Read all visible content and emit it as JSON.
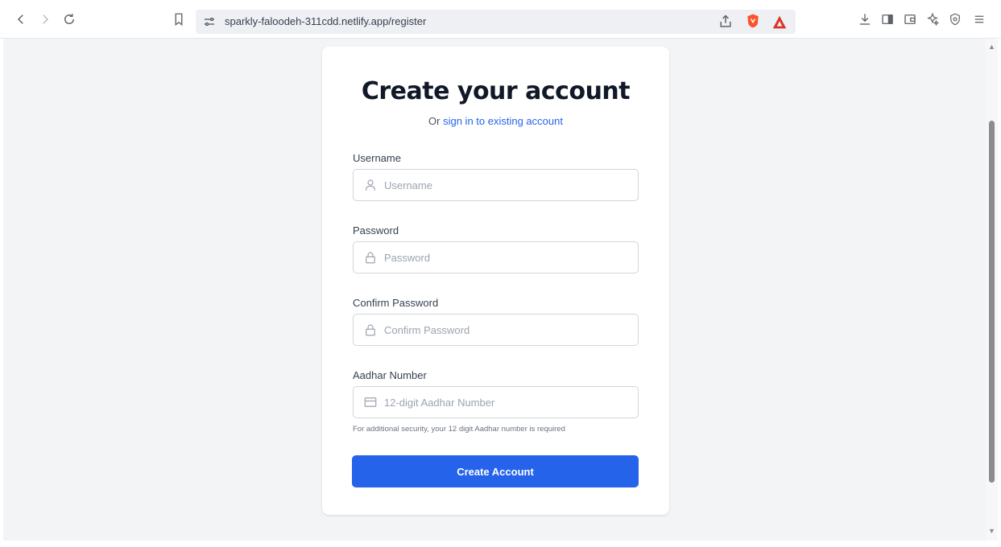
{
  "browser": {
    "url": "sparkly-faloodeh-311cdd.netlify.app/register",
    "icons": [
      "back-icon",
      "forward-icon",
      "reload-icon",
      "bookmark-icon",
      "site-settings-icon",
      "share-icon",
      "brave-shield-icon",
      "brave-rewards-icon",
      "download-icon",
      "sidebar-icon",
      "wallet-icon",
      "leo-ai-icon",
      "vpn-icon",
      "menu-icon"
    ]
  },
  "form": {
    "title": "Create your account",
    "subtitle_prefix": "Or ",
    "signin_link": "sign in to existing account",
    "username": {
      "label": "Username",
      "placeholder": "Username",
      "value": ""
    },
    "password": {
      "label": "Password",
      "placeholder": "Password",
      "value": ""
    },
    "confirm_password": {
      "label": "Confirm Password",
      "placeholder": "Confirm Password",
      "value": ""
    },
    "aadhar": {
      "label": "Aadhar Number",
      "placeholder": "12-digit Aadhar Number",
      "value": "",
      "help": "For additional security, your 12 digit Aadhar number is required"
    },
    "submit_label": "Create Account"
  },
  "colors": {
    "accent": "#2563eb",
    "page_bg": "#f3f4f6",
    "card_bg": "#ffffff",
    "title": "#111827"
  }
}
